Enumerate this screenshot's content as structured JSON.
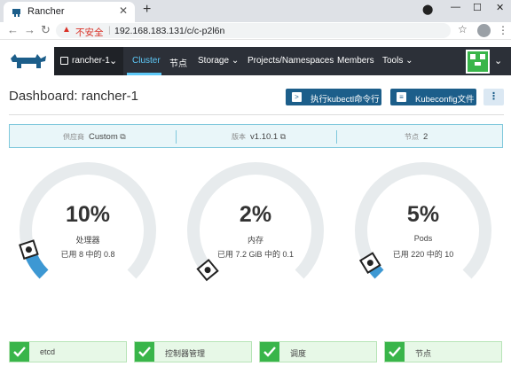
{
  "browser": {
    "tab_title": "Rancher",
    "address_warning": "不安全",
    "url": "192.168.183.131/c/c-p2l6n"
  },
  "nav": {
    "cluster_name": "rancher-1",
    "items": [
      "Cluster",
      "节点",
      "Storage",
      "Projects/Namespaces",
      "Members",
      "Tools"
    ],
    "active": "Cluster"
  },
  "page": {
    "title": "Dashboard: rancher-1",
    "kubectl_button": "执行kubectl命令行",
    "kubeconfig_button": "Kubeconfig文件",
    "more": "⋮"
  },
  "info": {
    "provider_label": "供应商",
    "provider_value": "Custom",
    "version_label": "版本",
    "version_value": "v1.10.1",
    "nodes_label": "节点",
    "nodes_value": "2"
  },
  "gauges": [
    {
      "value": "10%",
      "label": "处理器",
      "detail": "已用 8 中的 0.8",
      "fraction": 0.1
    },
    {
      "value": "2%",
      "label": "内存",
      "detail": "已用 7.2 GiB 中的 0.1",
      "fraction": 0.02
    },
    {
      "value": "5%",
      "label": "Pods",
      "detail": "已用 220 中的 10",
      "fraction": 0.05
    }
  ],
  "components": [
    {
      "label": "etcd"
    },
    {
      "label": "控制器管理"
    },
    {
      "label": "调度"
    },
    {
      "label": "节点"
    }
  ],
  "colors": {
    "gauge_track": "#e7ebed",
    "gauge_fill": "#3d98d3",
    "nav_bg": "#2c3038",
    "nav_active": "#5ec9f8",
    "primary": "#1c5e8a",
    "success": "#39b54a"
  }
}
